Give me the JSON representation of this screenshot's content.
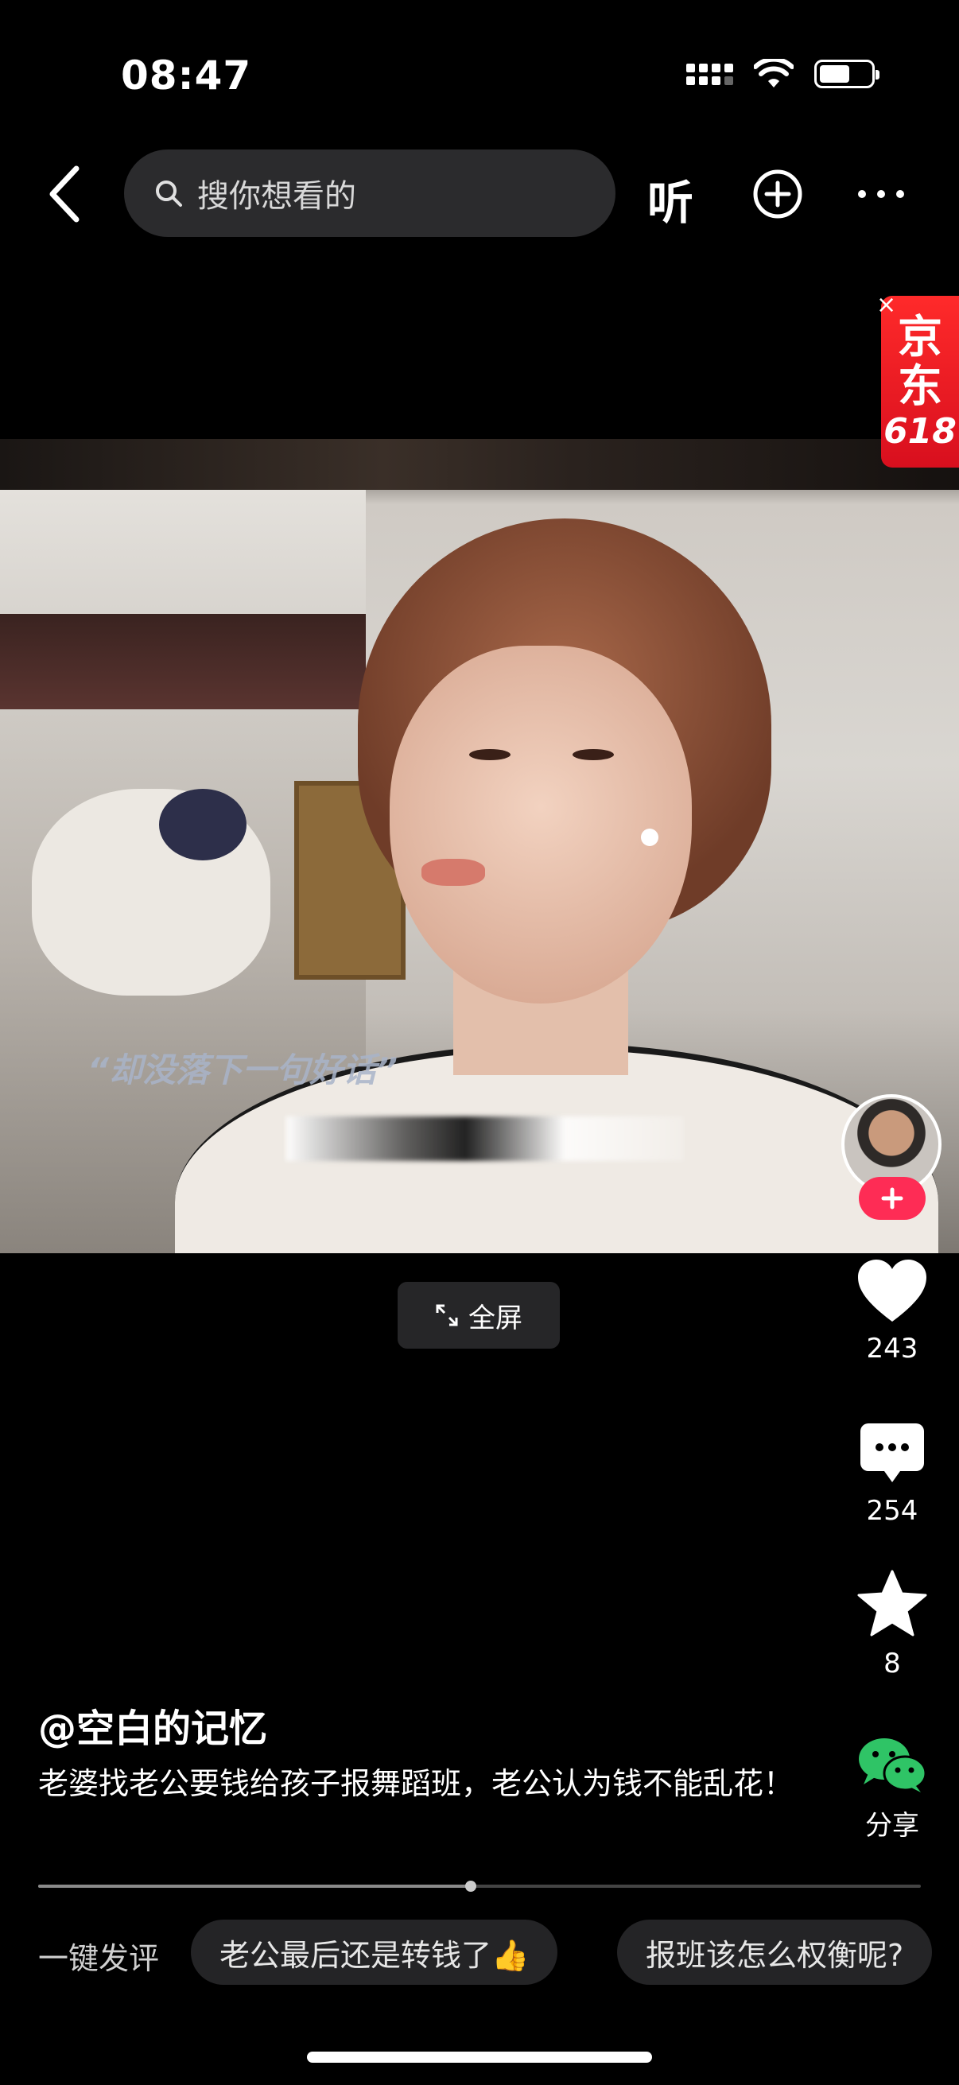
{
  "status_bar": {
    "time": "08:47"
  },
  "top_bar": {
    "search_placeholder": "搜你想看的",
    "listen_label": "听"
  },
  "ad": {
    "line1": "京",
    "line2": "东",
    "line3": "618",
    "close": "×"
  },
  "video": {
    "subtitle": "“却没落下一句好话”"
  },
  "fullscreen": {
    "label": "全屏"
  },
  "actions": {
    "like_count": "243",
    "comment_count": "254",
    "favorite_count": "8",
    "share_label": "分享"
  },
  "post": {
    "author": "@空白的记忆",
    "description": "老婆找老公要钱给孩子报舞蹈班，老公认为钱不能乱花！"
  },
  "progress": {
    "fraction": 0.49
  },
  "quick_comment": {
    "label": "一键发评",
    "chips": [
      "老公最后还是转钱了👍",
      "报班该怎么权衡呢?"
    ]
  },
  "colors": {
    "accent": "#fe2c55",
    "wechat_green": "#2fc466"
  }
}
